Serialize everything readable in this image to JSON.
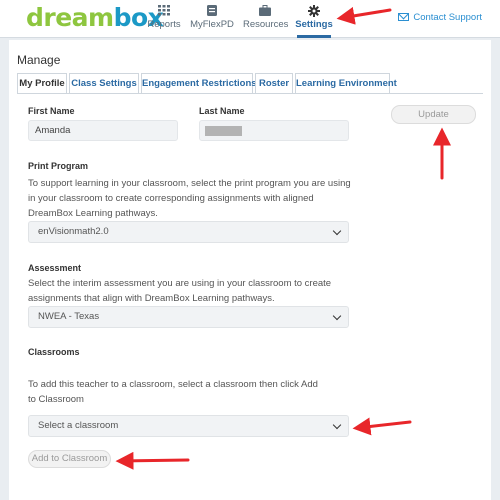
{
  "brand": {
    "logo_part1": "dream",
    "logo_part2": "box",
    "logo_mark": "TM",
    "green": "#8ec63f",
    "blue": "#1c99c6"
  },
  "nav": {
    "items": [
      {
        "label": "Reports",
        "icon": "grid-icon"
      },
      {
        "label": "MyFlexPD",
        "icon": "pd-icon"
      },
      {
        "label": "Resources",
        "icon": "briefcase-icon"
      },
      {
        "label": "Settings",
        "icon": "gear-icon",
        "active": true
      }
    ],
    "contact_label": "Contact Support",
    "accent": "#2b6aa3"
  },
  "page": {
    "title": "Manage"
  },
  "tabs": [
    "My Profile",
    "Class Settings",
    "Engagement Restrictions",
    "Roster",
    "Learning Environment"
  ],
  "profile": {
    "first_name_label": "First Name",
    "first_name_value": "Amanda",
    "last_name_label": "Last Name",
    "update_label": "Update"
  },
  "print_program": {
    "title": "Print Program",
    "description": "To support learning in your classroom, select the print program you are using in your classroom to create corresponding assignments with aligned DreamBox Learning pathways.",
    "selected": "enVisionmath2.0"
  },
  "assessment": {
    "title": "Assessment",
    "description": "Select the interim assessment you are using in your classroom to create assignments that align with DreamBox Learning pathways.",
    "selected": "NWEA - Texas"
  },
  "classrooms": {
    "title": "Classrooms",
    "description": "To add this teacher to a classroom, select a classroom then click Add to Classroom",
    "placeholder": "Select a classroom",
    "add_label": "Add to Classroom"
  },
  "annotation_color": "#e8262a"
}
